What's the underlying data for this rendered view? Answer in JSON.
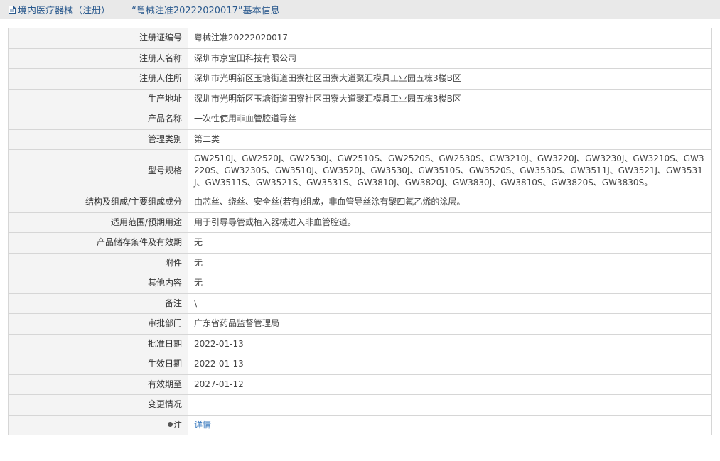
{
  "header": {
    "title": "境内医疗器械（注册） ——“粤械注准20222020017”基本信息"
  },
  "rows": [
    {
      "label": "注册证编号",
      "value": "粤械注准20222020017"
    },
    {
      "label": "注册人名称",
      "value": "深圳市京宝田科技有限公司"
    },
    {
      "label": "注册人住所",
      "value": "深圳市光明新区玉塘街道田寮社区田寮大道聚汇模具工业园五栋3楼B区"
    },
    {
      "label": "生产地址",
      "value": "深圳市光明新区玉塘街道田寮社区田寮大道聚汇模具工业园五栋3楼B区"
    },
    {
      "label": "产品名称",
      "value": "一次性使用非血管腔道导丝"
    },
    {
      "label": "管理类别",
      "value": "第二类"
    },
    {
      "label": "型号规格",
      "value": "GW2510J、GW2520J、GW2530J、GW2510S、GW2520S、GW2530S、GW3210J、GW3220J、GW3230J、GW3210S、GW3220S、GW3230S、GW3510J、GW3520J、GW3530J、GW3510S、GW3520S、GW3530S、GW3511J、GW3521J、GW3531J、GW3511S、GW3521S、GW3531S、GW3810J、GW3820J、GW3830J、GW3810S、GW3820S、GW3830S。"
    },
    {
      "label": "结构及组成/主要组成成分",
      "value": "由芯丝、绕丝、安全丝(若有)组成，非血管导丝涂有聚四氟乙烯的涂层。"
    },
    {
      "label": "适用范围/预期用途",
      "value": "用于引导导管或植入器械进入非血管腔道。"
    },
    {
      "label": "产品储存条件及有效期",
      "value": "无"
    },
    {
      "label": "附件",
      "value": "无"
    },
    {
      "label": "其他内容",
      "value": "无"
    },
    {
      "label": "备注",
      "value": "\\"
    },
    {
      "label": "审批部门",
      "value": "广东省药品监督管理局"
    },
    {
      "label": "批准日期",
      "value": "2022-01-13"
    },
    {
      "label": "生效日期",
      "value": "2022-01-13"
    },
    {
      "label": "有效期至",
      "value": "2027-01-12"
    },
    {
      "label": "变更情况",
      "value": ""
    }
  ],
  "note_row": {
    "label": "注",
    "link_text": "详情",
    "icon": "pin-icon"
  },
  "colors": {
    "header_bg": "#e9e9e9",
    "header_text": "#2b5a8e",
    "label_bg": "#f4f4f4",
    "link": "#3b7bbf"
  }
}
